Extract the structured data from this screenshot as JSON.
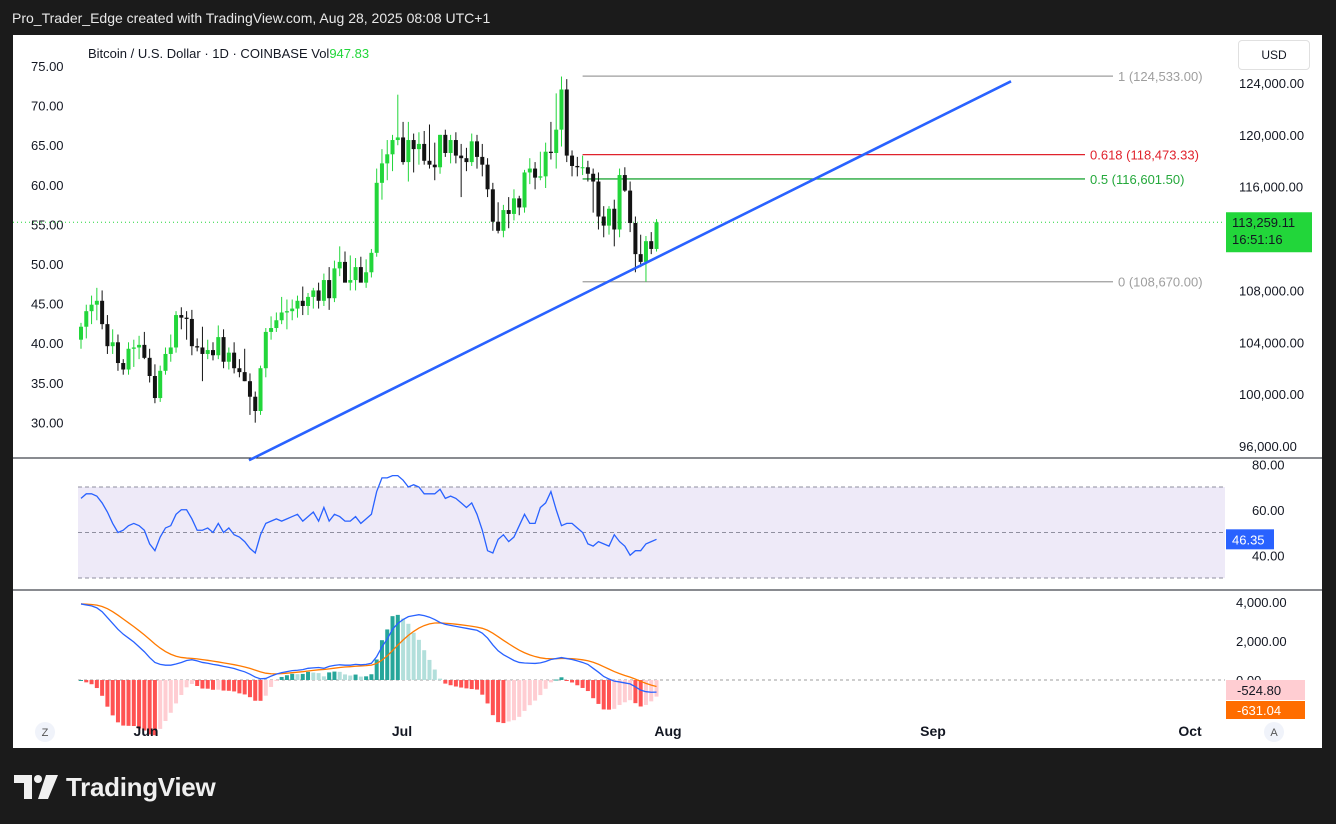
{
  "header": {
    "text": "Pro_Trader_Edge created with TradingView.com, Aug 28, 2025 08:08 UTC+1"
  },
  "legend": {
    "symbol": "Bitcoin / U.S. Dollar · 1D · COINBASE",
    "vol_label": "Vol",
    "vol_value": "947.83"
  },
  "currency": "USD",
  "footer": {
    "brand": "TradingView"
  },
  "corner": {
    "left": "Z",
    "right": "A"
  },
  "colors": {
    "up": "#22d63a",
    "down": "#131313",
    "trend": "#2962ff",
    "fib_red": "#e0222c",
    "fib_green": "#24a83b",
    "rsi_line": "#2962ff",
    "macd_line": "#2962ff",
    "signal_line": "#ff7a00"
  },
  "chart_data": [
    {
      "type": "candlestick",
      "title": "Bitcoin / U.S. Dollar · 1D · COINBASE",
      "right_axis_ticks": [
        "124,000.00",
        "120,000.00",
        "116,000.00",
        "112,000.00",
        "108,000.00",
        "104,000.00",
        "100,000.00",
        "96,000.00"
      ],
      "right_axis_values": [
        124000,
        120000,
        116000,
        112000,
        108000,
        104000,
        100000,
        96000
      ],
      "left_axis_ticks": [
        "75.00",
        "70.00",
        "65.00",
        "60.00",
        "55.00",
        "50.00",
        "45.00",
        "40.00",
        "35.00",
        "30.00"
      ],
      "x_labels": [
        "Jun",
        "Jul",
        "Aug",
        "Sep",
        "Oct"
      ],
      "ylim": [
        95500,
        124900
      ],
      "last_price": "113,259.11",
      "countdown": "16:51:16",
      "fib_levels": [
        {
          "label": "1 (124,533.00)",
          "price": 124533
        },
        {
          "label": "0.618 (118,473.33)",
          "price": 118473.33
        },
        {
          "label": "0.5 (116,601.50)",
          "price": 116601.5
        },
        {
          "label": "0 (108,670.00)",
          "price": 108670
        }
      ],
      "trendline": {
        "start": [
          "May 24",
          94900
        ],
        "end": [
          "Aug 26",
          124130
        ]
      },
      "candles": [
        [
          104200,
          105500,
          103500,
          105200
        ],
        [
          105200,
          106900,
          104300,
          106400
        ],
        [
          106400,
          107600,
          105400,
          106900
        ],
        [
          106900,
          108200,
          105700,
          107200
        ],
        [
          107200,
          108000,
          105000,
          105400
        ],
        [
          105400,
          106100,
          103100,
          103700
        ],
        [
          103700,
          105000,
          103100,
          104000
        ],
        [
          104000,
          104600,
          101800,
          102400
        ],
        [
          102400,
          102700,
          101500,
          101900
        ],
        [
          101900,
          104000,
          101500,
          103500
        ],
        [
          103500,
          104200,
          102100,
          103600
        ],
        [
          103600,
          104500,
          102700,
          103800
        ],
        [
          103800,
          104800,
          102700,
          102800
        ],
        [
          102800,
          103500,
          100900,
          101400
        ],
        [
          101400,
          102300,
          99300,
          99700
        ],
        [
          99700,
          102200,
          99400,
          101800
        ],
        [
          101800,
          103600,
          101500,
          103100
        ],
        [
          103100,
          104600,
          102500,
          103600
        ],
        [
          103600,
          106400,
          103200,
          106100
        ],
        [
          106100,
          106700,
          105000,
          105900
        ],
        [
          105900,
          106400,
          104200,
          105800
        ],
        [
          105800,
          106500,
          103000,
          103700
        ],
        [
          103700,
          104300,
          103300,
          103600
        ],
        [
          103600,
          105200,
          101000,
          103100
        ],
        [
          103100,
          104200,
          102700,
          103400
        ],
        [
          103400,
          104000,
          102600,
          103000
        ],
        [
          103000,
          105300,
          102700,
          104400
        ],
        [
          104400,
          105000,
          102000,
          102500
        ],
        [
          102500,
          103600,
          101900,
          103200
        ],
        [
          103200,
          104000,
          101600,
          102000
        ],
        [
          102000,
          102700,
          101300,
          101700
        ],
        [
          101700,
          103500,
          101000,
          101000
        ],
        [
          101000,
          101600,
          98400,
          99800
        ],
        [
          99800,
          100200,
          97800,
          98700
        ],
        [
          98700,
          102200,
          98400,
          102000
        ],
        [
          102000,
          105100,
          101300,
          104800
        ],
        [
          104800,
          106000,
          104200,
          105100
        ],
        [
          105100,
          106300,
          104800,
          105700
        ],
        [
          105700,
          107500,
          105400,
          106300
        ],
        [
          106300,
          107300,
          105000,
          106400
        ],
        [
          106400,
          107300,
          105700,
          106600
        ],
        [
          106600,
          107600,
          105900,
          107200
        ],
        [
          107200,
          108300,
          106100,
          106800
        ],
        [
          106800,
          107800,
          106100,
          107500
        ],
        [
          107500,
          108200,
          106600,
          108000
        ],
        [
          108000,
          108600,
          106600,
          107200
        ],
        [
          107200,
          109300,
          106800,
          108800
        ],
        [
          108800,
          109800,
          106500,
          107400
        ],
        [
          107400,
          110300,
          107100,
          109700
        ],
        [
          109700,
          111400,
          109100,
          110200
        ],
        [
          110200,
          111000,
          108700,
          108600
        ],
        [
          108600,
          110700,
          108000,
          108800
        ],
        [
          108800,
          110500,
          108000,
          109800
        ],
        [
          109800,
          110600,
          108700,
          108600
        ],
        [
          108600,
          110400,
          108200,
          109400
        ],
        [
          109400,
          111200,
          109000,
          110900
        ],
        [
          110900,
          117400,
          110600,
          116300
        ],
        [
          116300,
          118900,
          115000,
          117800
        ],
        [
          117800,
          119600,
          116500,
          118500
        ],
        [
          118500,
          120000,
          117200,
          119600
        ],
        [
          119600,
          123100,
          119200,
          119800
        ],
        [
          119800,
          121000,
          117700,
          117900
        ],
        [
          117900,
          121000,
          116400,
          119600
        ],
        [
          119600,
          120100,
          117100,
          118900
        ],
        [
          118900,
          120200,
          117700,
          119300
        ],
        [
          119300,
          120300,
          117700,
          118000
        ],
        [
          118000,
          120800,
          117400,
          117700
        ],
        [
          117700,
          119400,
          116500,
          117500
        ],
        [
          117500,
          120000,
          117000,
          120000
        ],
        [
          120000,
          120400,
          118300,
          118600
        ],
        [
          118600,
          120000,
          117800,
          119600
        ],
        [
          119600,
          120200,
          117800,
          118400
        ],
        [
          118400,
          119300,
          115200,
          118200
        ],
        [
          118200,
          119000,
          117200,
          117900
        ],
        [
          117900,
          120100,
          117600,
          119500
        ],
        [
          119500,
          120000,
          117400,
          118300
        ],
        [
          118300,
          119300,
          116800,
          117700
        ],
        [
          117700,
          118200,
          115200,
          115800
        ],
        [
          115800,
          116300,
          112600,
          113300
        ],
        [
          113300,
          114800,
          112400,
          112600
        ],
        [
          112600,
          114600,
          112100,
          114200
        ],
        [
          114200,
          115200,
          112800,
          113900
        ],
        [
          113900,
          115800,
          113400,
          115100
        ],
        [
          115100,
          115300,
          113800,
          114400
        ],
        [
          114400,
          117300,
          114000,
          117100
        ],
        [
          117100,
          118200,
          116200,
          117400
        ],
        [
          117400,
          117900,
          115800,
          116700
        ],
        [
          116700,
          118700,
          116500,
          116800
        ],
        [
          116800,
          119400,
          115900,
          118700
        ],
        [
          118700,
          121000,
          118100,
          118600
        ],
        [
          118600,
          123200,
          117400,
          120400
        ],
        [
          120400,
          124500,
          119100,
          123500
        ],
        [
          123500,
          124300,
          117900,
          118400
        ],
        [
          118400,
          118800,
          116800,
          117600
        ],
        [
          117600,
          118300,
          116800,
          117500
        ],
        [
          117500,
          118400,
          116900,
          117500
        ],
        [
          117500,
          118000,
          116400,
          117000
        ],
        [
          117000,
          117400,
          114000,
          116400
        ],
        [
          116400,
          117100,
          112700,
          113700
        ],
        [
          113700,
          114500,
          112100,
          113000
        ],
        [
          113000,
          114500,
          112300,
          114300
        ],
        [
          114300,
          115000,
          111400,
          112700
        ],
        [
          112700,
          117400,
          112100,
          116900
        ],
        [
          116900,
          117500,
          115600,
          115700
        ],
        [
          115700,
          116400,
          112500,
          113200
        ],
        [
          113200,
          113700,
          109400,
          110800
        ],
        [
          110800,
          112300,
          109800,
          110200
        ],
        [
          110200,
          112200,
          108670,
          111800
        ],
        [
          111800,
          112500,
          110800,
          111200
        ],
        [
          111200,
          113500,
          111000,
          113259
        ]
      ]
    },
    {
      "type": "line",
      "title": "RSI",
      "y_ticks": [
        "80.00",
        "60.00",
        "40.00"
      ],
      "band": [
        30,
        70
      ],
      "midline": 50,
      "last": "46.35",
      "values": [
        65,
        67,
        67,
        66,
        63,
        59,
        54,
        50,
        51,
        53,
        54,
        53,
        51,
        45,
        42,
        48,
        52,
        53,
        58,
        60,
        60,
        56,
        51,
        51,
        52,
        50,
        54,
        50,
        52,
        49,
        48,
        46,
        43,
        41,
        49,
        54,
        55,
        56,
        55,
        56,
        57,
        58,
        55,
        57,
        59,
        55,
        61,
        55,
        58,
        57,
        55,
        55,
        57,
        54,
        56,
        58,
        68,
        74,
        74,
        75,
        75,
        73,
        70,
        71,
        70,
        67,
        67,
        67,
        69,
        65,
        66,
        65,
        63,
        61,
        63,
        58,
        51,
        42,
        41,
        47,
        49,
        46,
        48,
        53,
        58,
        54,
        54,
        61,
        63,
        68,
        60,
        53,
        54,
        54,
        52,
        50,
        45,
        44,
        46,
        45,
        44,
        49,
        46,
        44,
        40,
        42,
        42,
        45,
        46,
        47
      ]
    },
    {
      "type": "line",
      "title": "MACD",
      "y_ticks": [
        "4,000.00",
        "2,000.00",
        "0.00"
      ],
      "macd_last": "-524.80",
      "signal_last": "-631.04",
      "macd": [
        3900,
        3850,
        3800,
        3700,
        3500,
        3200,
        2900,
        2600,
        2350,
        2150,
        1950,
        1700,
        1450,
        1150,
        900,
        800,
        760,
        760,
        820,
        900,
        1000,
        1040,
        980,
        900,
        860,
        800,
        760,
        700,
        650,
        590,
        500,
        420,
        300,
        150,
        60,
        80,
        200,
        300,
        380,
        430,
        480,
        500,
        530,
        600,
        620,
        640,
        600,
        700,
        750,
        780,
        760,
        760,
        800,
        780,
        800,
        860,
        1200,
        1700,
        2100,
        2600,
        2900,
        3100,
        3250,
        3300,
        3350,
        3300,
        3220,
        3100,
        2950,
        2850,
        2800,
        2750,
        2700,
        2650,
        2600,
        2550,
        2400,
        2150,
        1800,
        1500,
        1300,
        1150,
        1000,
        900,
        870,
        860,
        850,
        880,
        950,
        1050,
        1100,
        1150,
        1100,
        1050,
        980,
        900,
        800,
        600,
        400,
        180,
        50,
        -60,
        -100,
        -150,
        -200,
        -350,
        -520,
        -600,
        -630,
        -620
      ]
    }
  ]
}
